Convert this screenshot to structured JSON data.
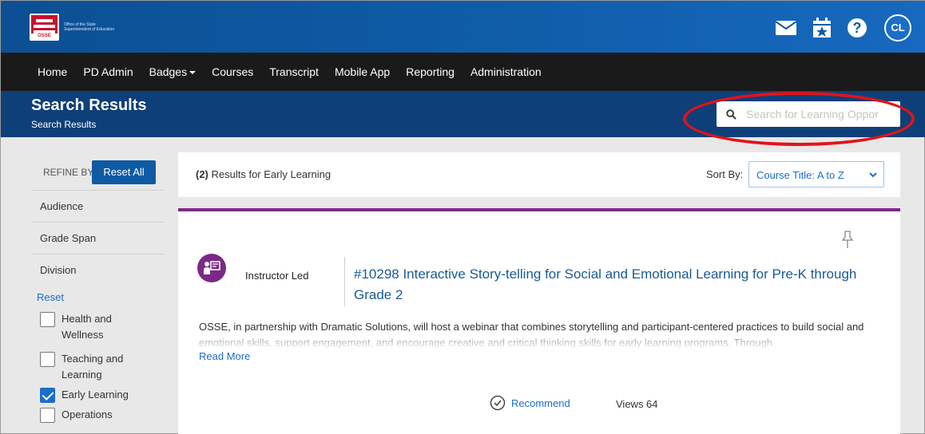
{
  "header": {
    "logo_badge": "OSSE",
    "logo_text": "Office of the State Superintendent of Education",
    "avatar_initials": "CL",
    "icons": [
      "mail-icon",
      "calendar-star-icon",
      "help-icon"
    ]
  },
  "nav": {
    "items": [
      "Home",
      "PD Admin",
      "Badges",
      "Courses",
      "Transcript",
      "Mobile App",
      "Reporting",
      "Administration"
    ]
  },
  "titleband": {
    "title": "Search Results",
    "breadcrumb": "Search Results",
    "search_placeholder": "Search for Learning Oppor"
  },
  "sidebar": {
    "refine_label": "REFINE BY",
    "reset_all": "Reset All",
    "facets": [
      "Audience",
      "Grade Span",
      "Division"
    ],
    "reset_link": "Reset",
    "checkboxes": [
      {
        "label": "Health and Wellness",
        "checked": false
      },
      {
        "label": "Teaching and Learning",
        "checked": false
      },
      {
        "label": "Early Learning",
        "checked": true
      },
      {
        "label": "Operations",
        "checked": false
      }
    ]
  },
  "results": {
    "count": "(2)",
    "query_text": " Results for Early Learning",
    "sort_label": "Sort By:",
    "sort_value": "Course Title: A to Z"
  },
  "card": {
    "type": "Instructor Led",
    "title": "#10298 Interactive Story-telling for Social and Emotional Learning for Pre-K through Grade 2",
    "description": "OSSE, in partnership with Dramatic Solutions, will host a webinar that combines storytelling and participant-centered practices to build social and emotional skills, support engagement, and encourage creative and critical thinking skills for early learning programs. Through",
    "read_more": "Read More",
    "recommend_label": "Recommend",
    "views": "Views 64"
  },
  "colors": {
    "header_blue": "#0e5aa4",
    "nav_black": "#1a1a1a",
    "title_band": "#0f3f78",
    "accent_purple": "#7a2a86",
    "link_blue": "#1a6fc9",
    "highlight_red": "#e0141a"
  }
}
